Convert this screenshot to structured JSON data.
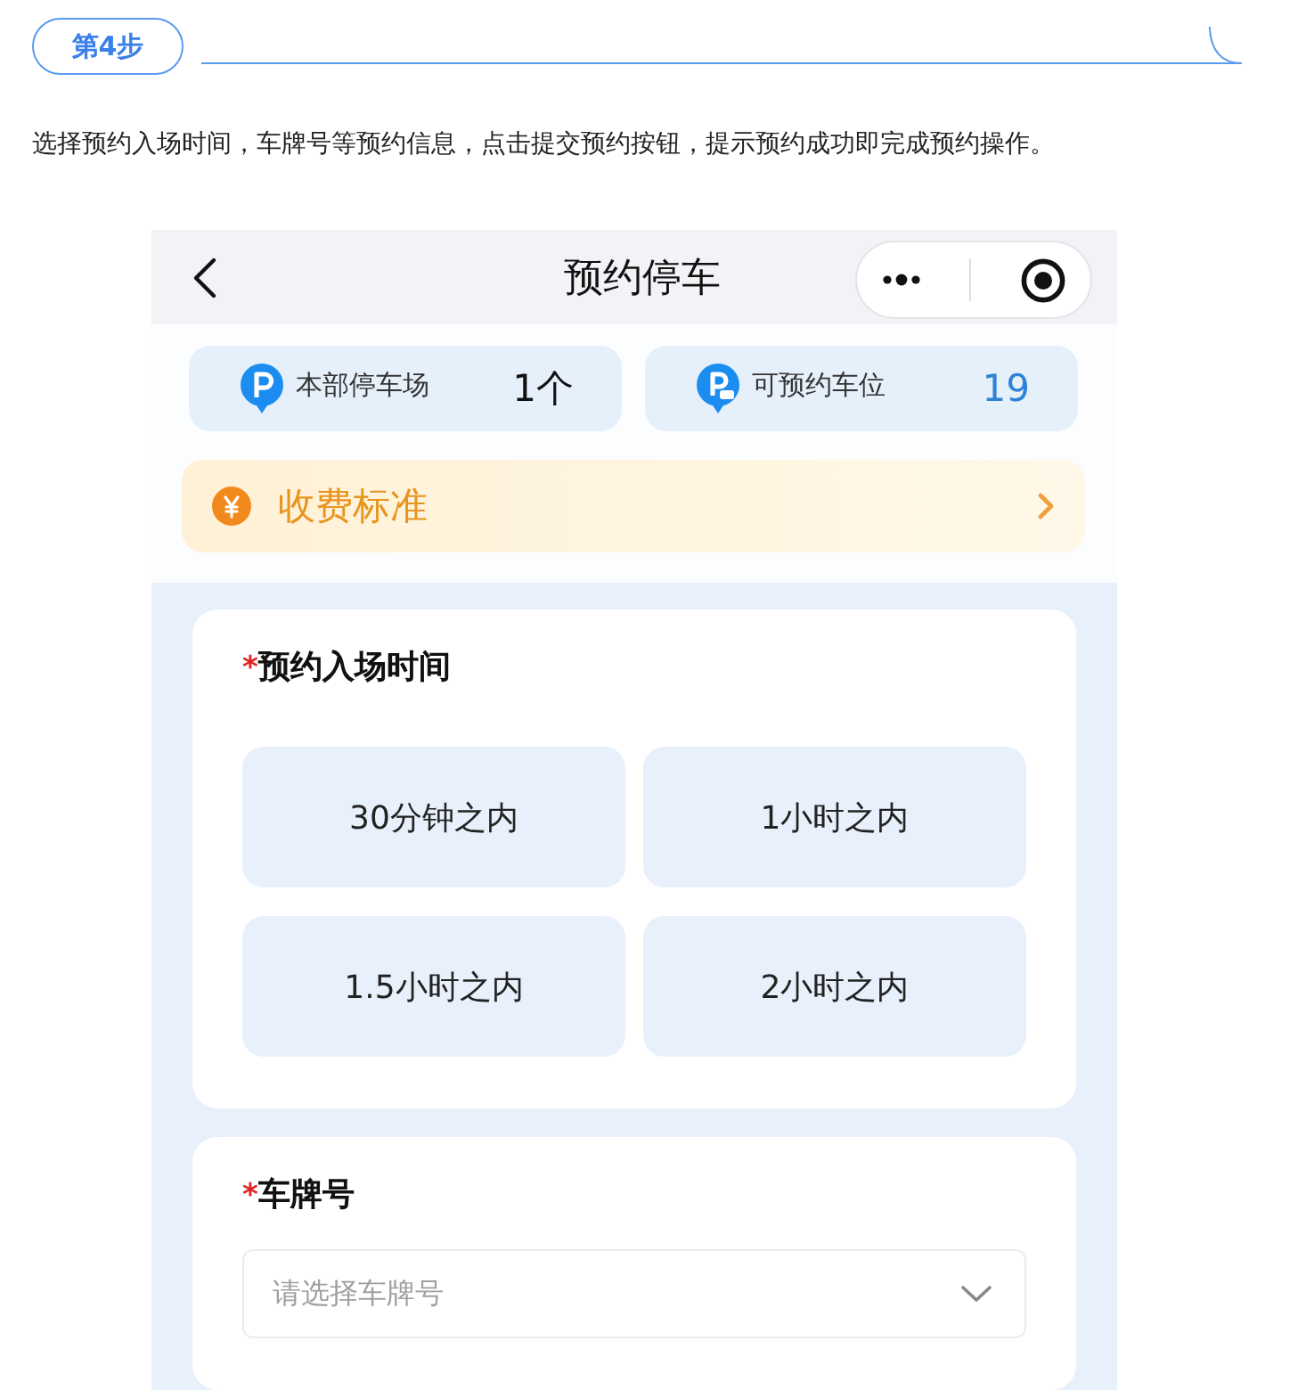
{
  "step_badge": "第4步",
  "instruction": "选择预约入场时间，车牌号等预约信息，点击提交预约按钮，提示预约成功即完成预约操作。",
  "phone": {
    "nav_bar": {
      "title": "预约停车"
    },
    "stats": [
      {
        "kind": "lots",
        "label": "本部停车场",
        "value": "1个"
      },
      {
        "kind": "spaces",
        "label": "可预约车位",
        "value": "19"
      }
    ],
    "fee_banner": {
      "label": "收费标准"
    },
    "entry_time": {
      "required_mark": "*",
      "label": "预约入场时间",
      "options": [
        {
          "label": "30分钟之内",
          "selected": false
        },
        {
          "label": "1小时之内",
          "selected": false
        },
        {
          "label": "1.5小时之内",
          "selected": false
        },
        {
          "label": "2小时之内",
          "selected": false
        }
      ]
    },
    "plate": {
      "required_mark": "*",
      "label": "车牌号",
      "placeholder": "请选择车牌号"
    }
  }
}
